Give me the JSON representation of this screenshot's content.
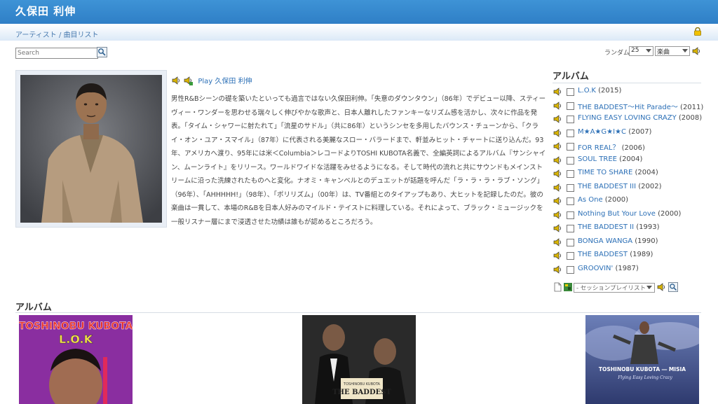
{
  "header": {
    "title": "久保田 利伸"
  },
  "breadcrumb": {
    "artists": "アーティスト",
    "sep": "/",
    "tracks": "曲目リスト"
  },
  "toolbar": {
    "search_placeholder": "Search",
    "random_label": "ランダム:",
    "random_count": "25",
    "random_type": "楽曲"
  },
  "artist": {
    "play_label": "Play 久保田 利伸",
    "bio": "男性R&Bシーンの礎を築いたといっても過言ではない久保田利伸。「失意のダウンタウン」（86年）でデビュー以降、スティーヴィー・ワンダーを思わせる瑞々しく伸びやかな歌声と、日本人離れしたファンキーなリズム感を活かし、次々に作品を発表。「タイム・シャワーに射たれて」「流星のサドル」（共に86年）というシンセを多用したバウンス・チューンから、「クライ・オン・ユア・スマイル」（87年）に代表される美麗なスロー・バラードまで、軒並みヒット・チャートに送り込んだ。93年、アメリカへ渡り、95年には米＜Columbia＞レコードよりTOSHI KUBOTA名義で、全編英詞によるアルバム『サンシャイン、ムーンライト』をリリース。ワールドワイドな活躍をみせるようになる。そして時代の流れと共にサウンドもメインストリームに沿った洗練されたものへと変化。ナオミ・キャンベルとのデュエットが話題を呼んだ「ラ・ラ・ラ・ラブ・ソング」（96年）、「AHHHHH!」（98年）、「ポリリズム」（00年）は、TV番組とのタイアップもあり、大ヒットを記録したのだ。彼の楽曲は一貫して、本場のR&Bを日本人好みのマイルド・テイストに料理している。それによって、ブラック・ミュージックを一般リスナー層にまで浸透させた功績は誰もが認めるところだろう。"
  },
  "albums_sidebar": {
    "heading": "アルバム",
    "items": [
      {
        "name": "L.O.K",
        "year": "(2015)"
      },
      {
        "name": "THE BADDEST～Hit Parade～",
        "year": "(2011)"
      },
      {
        "name": "FLYING EASY LOVING CRAZY",
        "year": "(2008)"
      },
      {
        "name": "M★A★G★I★C",
        "year": "(2007)"
      },
      {
        "name": "FOR REAL？",
        "year": "(2006)"
      },
      {
        "name": "SOUL TREE",
        "year": "(2004)"
      },
      {
        "name": "TIME TO SHARE",
        "year": "(2004)"
      },
      {
        "name": "THE BADDEST III",
        "year": "(2002)"
      },
      {
        "name": "As One",
        "year": "(2000)"
      },
      {
        "name": "Nothing But Your Love",
        "year": "(2000)"
      },
      {
        "name": "THE BADDEST II",
        "year": "(1993)"
      },
      {
        "name": "BONGA WANGA",
        "year": "(1990)"
      },
      {
        "name": "THE BADDEST",
        "year": "(1989)"
      },
      {
        "name": "GROOVIN'",
        "year": "(1987)"
      }
    ],
    "session_select": "- セッションプレイリスト -"
  },
  "albums_section": {
    "heading": "アルバム",
    "covers": [
      {
        "title_top": "TOSHINOBU KUBOTA",
        "title_sub": "L.O.K"
      },
      {
        "title_top": "TOSHINOBU KUBOTA",
        "title_sub": "THE BADDEST"
      },
      {
        "title_top": "TOSHINOBU KUBOTA ― MISIA",
        "title_sub": "Flying Easy Loving Crazy"
      }
    ]
  },
  "colors": {
    "title_bar": "#2f7fc6",
    "link": "#2b6fb6"
  }
}
